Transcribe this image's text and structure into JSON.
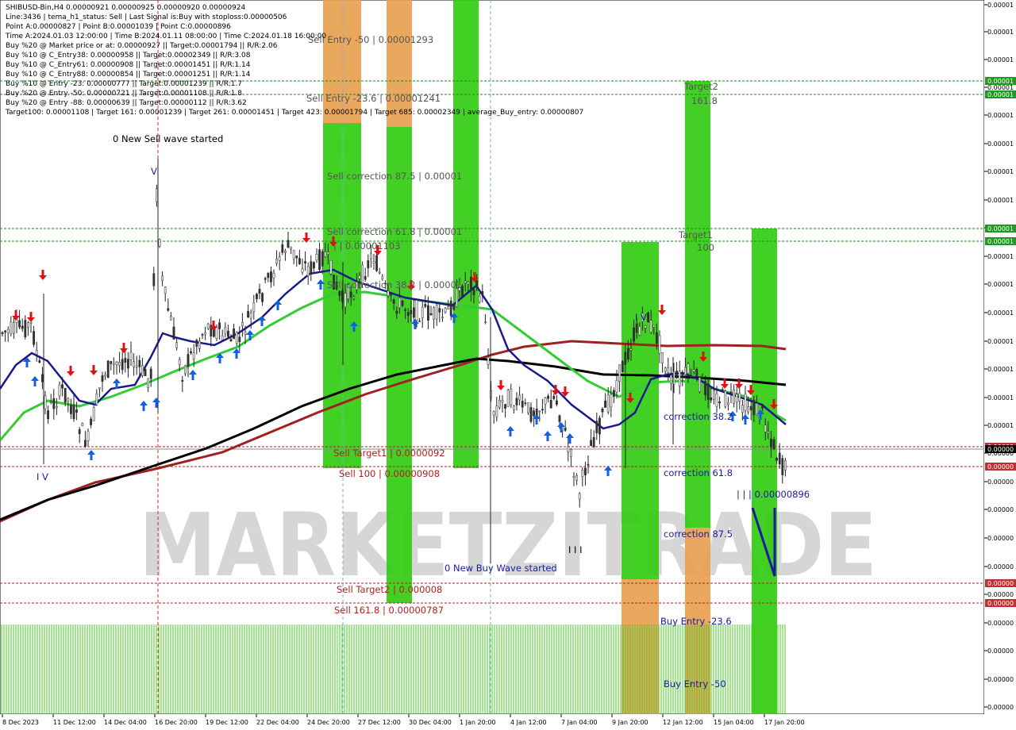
{
  "header": {
    "symbol_line": "SHIBUSD-Bin,H4  0.00000921 0.00000925 0.00000920 0.00000924",
    "info_lines": [
      "Line:3436 | tema_h1_status: Sell | Last Signal is:Buy with stoploss:0.00000506",
      "Point A:0.00000827 | Point B:0.00001039 | Point C:0.00000896",
      "Time A:2024.01.03 12:00:00 | Time B:2024.01.11 08:00:00 | Time C:2024.01.18 16:00:00",
      "Buy %20 @ Market price or at: 0.00000927 || Target:0.00001794 || R/R:2.06",
      "Buy %10 @ C_Entry38: 0.00000958 || Target:0.00002349 || R/R:3.08",
      "Buy %10 @ C_Entry61: 0.00000908 || Target:0.00001451 || R/R:1.14",
      "Buy %10 @ C_Entry88: 0.00000854 || Target:0.00001251 || R/R:1.14",
      "Buy %10 @ Entry -23: 0.00000777 || Target:0.00001239 || R/R:1.7",
      "Buy %20 @ Entry -50: 0.00000721 || Target:0.00001108 || R/R:1.8",
      "Buy %20 @ Entry -88: 0.00000639 || Target:0.00000112 || R/R:3.62",
      "Target100: 0.00001108 | Target 161: 0.00001239 | Target 261: 0.00001451 | Target 423: 0.00001794 | Target 685: 0.00002349 | average_Buy_entry: 0.00000807"
    ]
  },
  "plot_labels": {
    "new_sell_wave": "0 New Sell wave started",
    "sell_entry_50": "Sell Entry -50 | 0.00001293",
    "sell_entry_23": "Sell Entry -23.6 | 0.00001241",
    "sell_corr_875": "Sell correction 87.5 | 0.00001",
    "sell_corr_618": "Sell correction 61.8 | 0.00001",
    "sell_corr_382": "Sell correction 38.2 | 0.00001",
    "point_price_label": "| | 0.00001103",
    "target2": "Target2",
    "target2_val": "161.8",
    "target1": "Target1",
    "target1_val": "100",
    "sell_target1": "Sell Target1 | 0.0000092",
    "sell_100": "Sell 100 | 0.00000908",
    "sell_target2": "Sell Target2 | 0.000008",
    "sell_1618": "Sell 161.8 | 0.00000787",
    "new_buy_wave": "0 New Buy Wave started",
    "correction_382": "correction 38.2",
    "correction_618": "correction 61.8",
    "correction_875": "correction 87.5",
    "buy_entry_23": "Buy Entry -23.6",
    "buy_entry_50": "Buy Entry -50",
    "point_c_label": "| | | 0.00000896",
    "wave_iv": "I V",
    "wave_iii": "I I I",
    "wave_v_top": "V",
    "wave_iv_top": "I V",
    "watermark": "MARKETZITRADE"
  },
  "price_axis": {
    "ticks": [
      "0.00001",
      "0.00001",
      "0.00001",
      "0.00001",
      "0.00001",
      "0.00001",
      "0.00001",
      "0.00001",
      "0.00001",
      "0.00001",
      "0.00001",
      "0.00001",
      "0.00001",
      "0.00001",
      "0.00001",
      "0.00001",
      "0.00000",
      "0.00000",
      "0.00000",
      "0.00000",
      "0.00000",
      "0.00000",
      "0.00000",
      "0.00000",
      "0.00000",
      "0.00000"
    ],
    "boxes": [
      {
        "label": "0.00001",
        "color": "#1e9a1e"
      },
      {
        "label": "0.00001",
        "color": "#1e9a1e"
      },
      {
        "label": "0.00001",
        "color": "#1e9a1e"
      },
      {
        "label": "0.00001",
        "color": "#1e9a1e"
      },
      {
        "label": "0.00000",
        "color": "#c03030"
      },
      {
        "label": "0.00000",
        "color": "#000000"
      },
      {
        "label": "0.00000",
        "color": "#c03030"
      },
      {
        "label": "0.00000",
        "color": "#c03030"
      },
      {
        "label": "0.00000",
        "color": "#c03030"
      }
    ]
  },
  "time_axis": {
    "ticks": [
      "8 Dec 2023",
      "11 Dec 12:00",
      "14 Dec 04:00",
      "16 Dec 20:00",
      "19 Dec 12:00",
      "22 Dec 04:00",
      "24 Dec 20:00",
      "27 Dec 12:00",
      "30 Dec 04:00",
      "1 Jan 20:00",
      "4 Jan 12:00",
      "7 Jan 04:00",
      "9 Jan 20:00",
      "12 Jan 12:00",
      "15 Jan 04:00",
      "17 Jan 20:00"
    ]
  },
  "colors": {
    "bull_green": "#33cc11",
    "bull_green_light": "#66ee33",
    "orange": "#e8a050",
    "blue_ma": "#1a1a8c",
    "green_ma": "#33cc33",
    "black_ma": "#000000",
    "red_ma": "#a02020",
    "sell_arrow": "#e01010",
    "buy_arrow": "#1060e0",
    "level_green": "#1a8a1a",
    "level_red": "#b02020"
  },
  "chart_data": {
    "type": "candlestick",
    "symbol": "SHIBUSD-Bin",
    "timeframe": "H4",
    "last_ohlc": {
      "open": 9.21e-06,
      "high": 9.25e-06,
      "low": 9.2e-06,
      "close": 9.24e-06
    },
    "points": {
      "A": 8.27e-06,
      "B": 1.039e-05,
      "C": 8.96e-06
    },
    "levels": [
      {
        "name": "Sell Entry -50",
        "value": 1.293e-05
      },
      {
        "name": "Sell Entry -23.6",
        "value": 1.241e-05
      },
      {
        "name": "Target2 161.8",
        "value": 1.239e-05
      },
      {
        "name": "Target1 100",
        "value": 1.108e-05
      },
      {
        "name": "Sell Target1",
        "value": 9.2e-06
      },
      {
        "name": "Sell 100",
        "value": 9.08e-06
      },
      {
        "name": "Sell Target2",
        "value": 8e-06
      },
      {
        "name": "Sell 161.8",
        "value": 7.87e-06
      }
    ]
  }
}
